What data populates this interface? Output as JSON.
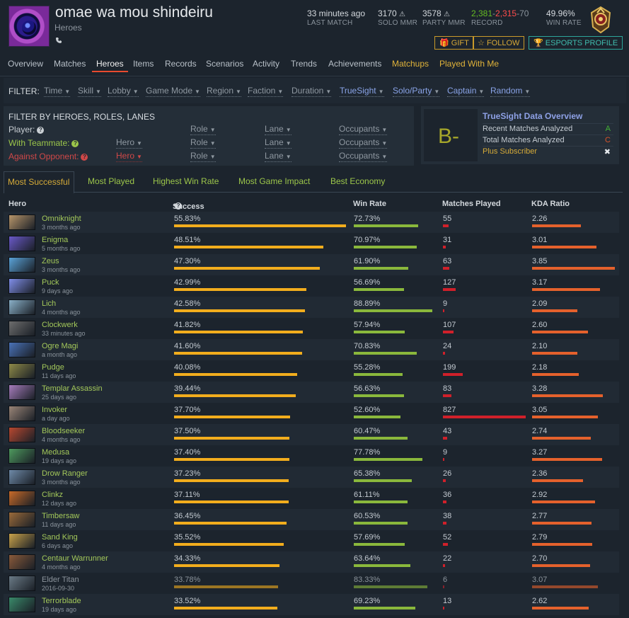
{
  "player": {
    "name": "omae wa mou shindeiru",
    "subtitle": "Heroes",
    "phone_icon": "phone-icon"
  },
  "stats": {
    "last_match": {
      "value": "33 minutes ago",
      "label": "LAST MATCH"
    },
    "solo_mmr": {
      "value": "3170",
      "label": "SOLO MMR"
    },
    "party_mmr": {
      "value": "3578",
      "label": "PARTY MMR"
    },
    "record": {
      "wins": "2,381",
      "losses": "2,315",
      "abandons": "70",
      "label": "RECORD"
    },
    "win_rate": {
      "value": "49.96%",
      "label": "WIN RATE"
    }
  },
  "buttons": {
    "gift": "GIFT",
    "follow": "FOLLOW",
    "esports": "ESPORTS PROFILE"
  },
  "tabs": [
    "Overview",
    "Matches",
    "Heroes",
    "Items",
    "Records",
    "Scenarios",
    "Activity",
    "Trends",
    "Achievements",
    "Matchups",
    "Played With Me"
  ],
  "active_tab": "Heroes",
  "filter": {
    "label": "FILTER:",
    "items": [
      "Time",
      "Skill",
      "Lobby",
      "Game Mode",
      "Region",
      "Faction",
      "Duration",
      "TrueSight",
      "Solo/Party",
      "Captain",
      "Random"
    ]
  },
  "hero_filter": {
    "title": "FILTER BY HEROES, ROLES, LANES",
    "rows": [
      {
        "label": "Player:",
        "hero": "",
        "role": "Role",
        "lane": "Lane",
        "occupants": "Occupants"
      },
      {
        "label": "With Teammate:",
        "hero": "Hero",
        "role": "Role",
        "lane": "Lane",
        "occupants": "Occupants"
      },
      {
        "label": "Against Opponent:",
        "hero": "Hero",
        "role": "Role",
        "lane": "Lane",
        "occupants": "Occupants"
      }
    ]
  },
  "truesight": {
    "grade": "B-",
    "title": "TrueSight Data Overview",
    "rows": [
      {
        "label": "Recent Matches Analyzed",
        "value": "A"
      },
      {
        "label": "Total Matches Analyzed",
        "value": "C"
      },
      {
        "label": "Plus Subscriber",
        "value": "✖"
      }
    ],
    "colors": {
      "A": "#44b336",
      "C": "#d8542a"
    }
  },
  "table_tabs": [
    "Most Successful",
    "Most Played",
    "Highest Win Rate",
    "Most Game Impact",
    "Best Economy"
  ],
  "active_table_tab": "Most Successful",
  "columns": {
    "hero": "Hero",
    "success": "Success",
    "win_rate": "Win Rate",
    "matches": "Matches Played",
    "kda": "KDA Ratio"
  },
  "heroes": [
    {
      "name": "Omniknight",
      "time": "3 months ago",
      "success": "55.83%",
      "success_v": 55.83,
      "win": "72.73%",
      "win_v": 72.73,
      "matches": "55",
      "matches_v": 55,
      "kda": "2.26",
      "kda_v": 2.26,
      "color": "#b7956a"
    },
    {
      "name": "Enigma",
      "time": "5 months ago",
      "success": "48.51%",
      "success_v": 48.51,
      "win": "70.97%",
      "win_v": 70.97,
      "matches": "31",
      "matches_v": 31,
      "kda": "3.01",
      "kda_v": 3.01,
      "color": "#6a59c8"
    },
    {
      "name": "Zeus",
      "time": "3 months ago",
      "success": "47.30%",
      "success_v": 47.3,
      "win": "61.90%",
      "win_v": 61.9,
      "matches": "63",
      "matches_v": 63,
      "kda": "3.85",
      "kda_v": 3.85,
      "color": "#5aa3d8"
    },
    {
      "name": "Puck",
      "time": "9 days ago",
      "success": "42.99%",
      "success_v": 42.99,
      "win": "56.69%",
      "win_v": 56.69,
      "matches": "127",
      "matches_v": 127,
      "kda": "3.17",
      "kda_v": 3.17,
      "color": "#7f8de8"
    },
    {
      "name": "Lich",
      "time": "4 months ago",
      "success": "42.58%",
      "success_v": 42.58,
      "win": "88.89%",
      "win_v": 88.89,
      "matches": "9",
      "matches_v": 9,
      "kda": "2.09",
      "kda_v": 2.09,
      "color": "#8ab0c8"
    },
    {
      "name": "Clockwerk",
      "time": "33 minutes ago",
      "success": "41.82%",
      "success_v": 41.82,
      "win": "57.94%",
      "win_v": 57.94,
      "matches": "107",
      "matches_v": 107,
      "kda": "2.60",
      "kda_v": 2.6,
      "color": "#6d6d6d"
    },
    {
      "name": "Ogre Magi",
      "time": "a month ago",
      "success": "41.60%",
      "success_v": 41.6,
      "win": "70.83%",
      "win_v": 70.83,
      "matches": "24",
      "matches_v": 24,
      "kda": "2.10",
      "kda_v": 2.1,
      "color": "#4a72b8"
    },
    {
      "name": "Pudge",
      "time": "11 days ago",
      "success": "40.08%",
      "success_v": 40.08,
      "win": "55.28%",
      "win_v": 55.28,
      "matches": "199",
      "matches_v": 199,
      "kda": "2.18",
      "kda_v": 2.18,
      "color": "#8e8a48"
    },
    {
      "name": "Templar Assassin",
      "time": "25 days ago",
      "success": "39.44%",
      "success_v": 39.44,
      "win": "56.63%",
      "win_v": 56.63,
      "matches": "83",
      "matches_v": 83,
      "kda": "3.28",
      "kda_v": 3.28,
      "color": "#a67cbc"
    },
    {
      "name": "Invoker",
      "time": "a day ago",
      "success": "37.70%",
      "success_v": 37.7,
      "win": "52.60%",
      "win_v": 52.6,
      "matches": "827",
      "matches_v": 827,
      "kda": "3.05",
      "kda_v": 3.05,
      "color": "#9a8577"
    },
    {
      "name": "Bloodseeker",
      "time": "4 months ago",
      "success": "37.50%",
      "success_v": 37.5,
      "win": "60.47%",
      "win_v": 60.47,
      "matches": "43",
      "matches_v": 43,
      "kda": "2.74",
      "kda_v": 2.74,
      "color": "#b84830"
    },
    {
      "name": "Medusa",
      "time": "19 days ago",
      "success": "37.40%",
      "success_v": 37.4,
      "win": "77.78%",
      "win_v": 77.78,
      "matches": "9",
      "matches_v": 9,
      "kda": "3.27",
      "kda_v": 3.27,
      "color": "#4e9a5e"
    },
    {
      "name": "Drow Ranger",
      "time": "3 months ago",
      "success": "37.23%",
      "success_v": 37.23,
      "win": "65.38%",
      "win_v": 65.38,
      "matches": "26",
      "matches_v": 26,
      "kda": "2.36",
      "kda_v": 2.36,
      "color": "#6e8aa8"
    },
    {
      "name": "Clinkz",
      "time": "12 days ago",
      "success": "37.11%",
      "success_v": 37.11,
      "win": "61.11%",
      "win_v": 61.11,
      "matches": "36",
      "matches_v": 36,
      "kda": "2.92",
      "kda_v": 2.92,
      "color": "#c86a28"
    },
    {
      "name": "Timbersaw",
      "time": "11 days ago",
      "success": "36.45%",
      "success_v": 36.45,
      "win": "60.53%",
      "win_v": 60.53,
      "matches": "38",
      "matches_v": 38,
      "kda": "2.77",
      "kda_v": 2.77,
      "color": "#9a6a3a"
    },
    {
      "name": "Sand King",
      "time": "6 days ago",
      "success": "35.52%",
      "success_v": 35.52,
      "win": "57.69%",
      "win_v": 57.69,
      "matches": "52",
      "matches_v": 52,
      "kda": "2.79",
      "kda_v": 2.79,
      "color": "#c8a24a"
    },
    {
      "name": "Centaur Warrunner",
      "time": "4 months ago",
      "success": "34.33%",
      "success_v": 34.33,
      "win": "63.64%",
      "win_v": 63.64,
      "matches": "22",
      "matches_v": 22,
      "kda": "2.70",
      "kda_v": 2.7,
      "color": "#8a5a3a"
    },
    {
      "name": "Elder Titan",
      "time": "2016-09-30",
      "success": "33.78%",
      "success_v": 33.78,
      "win": "83.33%",
      "win_v": 83.33,
      "matches": "6",
      "matches_v": 6,
      "kda": "3.07",
      "kda_v": 3.07,
      "color": "#6a7a86",
      "dim": true
    },
    {
      "name": "Terrorblade",
      "time": "19 days ago",
      "success": "33.52%",
      "success_v": 33.52,
      "win": "69.23%",
      "win_v": 69.23,
      "matches": "13",
      "matches_v": 13,
      "kda": "2.62",
      "kda_v": 2.62,
      "color": "#3a8a6a"
    }
  ],
  "bar_colors": {
    "success": "#f2ad1d",
    "win": "#8ab83c",
    "matches": "#d0202a",
    "kda": "#e5612c"
  }
}
